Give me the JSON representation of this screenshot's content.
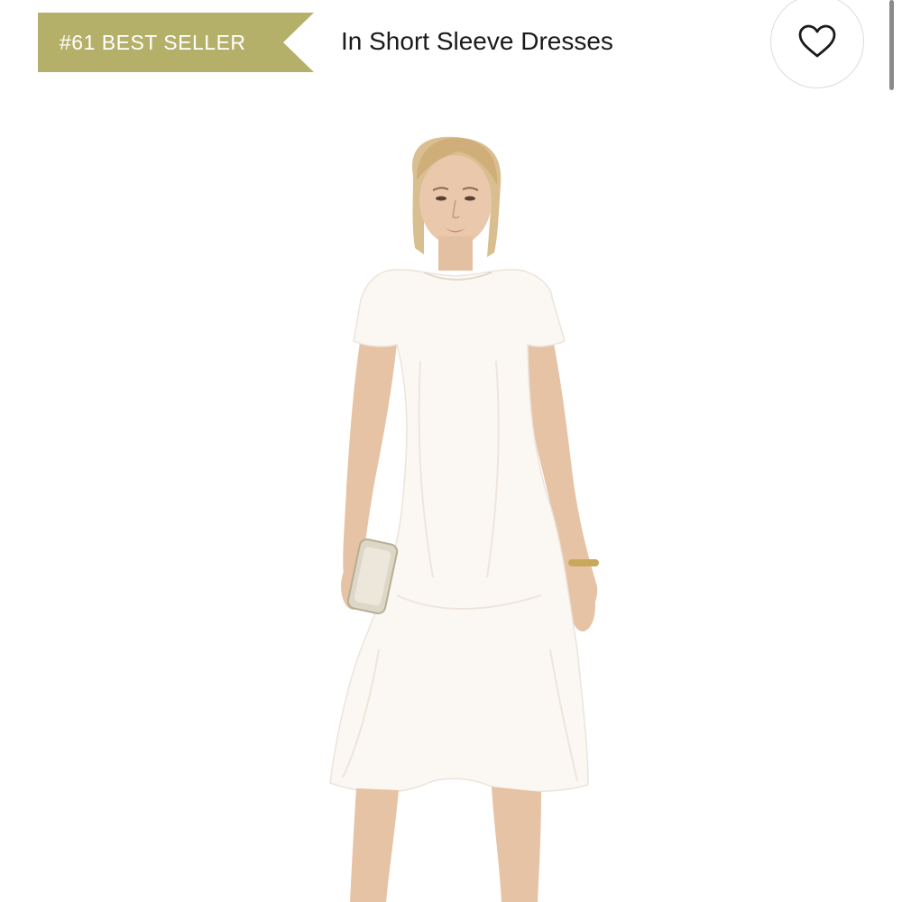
{
  "badge": {
    "label": "#61 BEST SELLER",
    "color": "#b5b069"
  },
  "category": {
    "label": "In Short Sleeve Dresses"
  },
  "favorite": {
    "icon": "heart-icon"
  },
  "product": {
    "image_subject": "model-in-white-short-sleeve-midi-dress",
    "dress_color": "#fbf8f4",
    "accessory": "silver-clutch"
  },
  "colors": {
    "background": "#ffffff",
    "text": "#1a1a1a",
    "border": "#dcdcdc"
  }
}
